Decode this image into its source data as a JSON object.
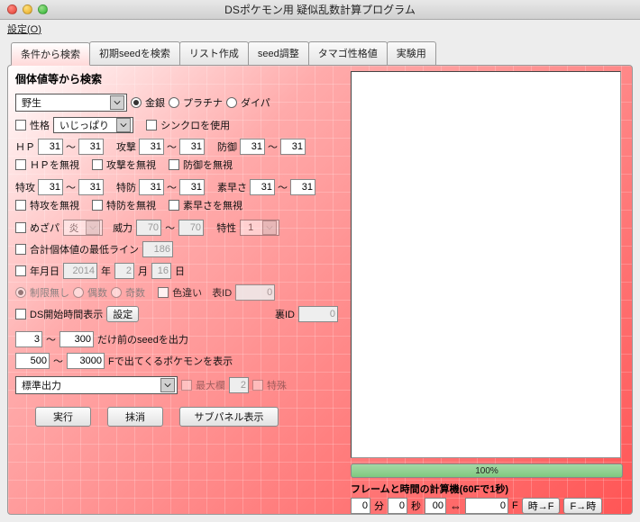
{
  "window": {
    "title": "DSポケモン用 疑似乱数計算プログラム",
    "menu_settings": "設定",
    "menu_settings_key": "O"
  },
  "tabs": [
    "条件から検索",
    "初期seedを検索",
    "リスト作成",
    "seed調整",
    "タマゴ性格値",
    "実験用"
  ],
  "heading": "個体値等から検索",
  "encounter": {
    "type": "野生",
    "game_opts": {
      "gs": "金銀",
      "pt": "プラチナ",
      "dp": "ダイパ"
    }
  },
  "nature": {
    "label": "性格",
    "value": "いじっぱり",
    "sync_label": "シンクロを使用"
  },
  "stats": {
    "hp_label": "ＨＰ",
    "atk_label": "攻撃",
    "def_label": "防御",
    "spa_label": "特攻",
    "spd_label": "特防",
    "spe_label": "素早さ",
    "hp": {
      "lo": "31",
      "hi": "31"
    },
    "atk": {
      "lo": "31",
      "hi": "31"
    },
    "def": {
      "lo": "31",
      "hi": "31"
    },
    "spa": {
      "lo": "31",
      "hi": "31"
    },
    "spd": {
      "lo": "31",
      "hi": "31"
    },
    "spe": {
      "lo": "31",
      "hi": "31"
    },
    "ignore_hp": "ＨＰを無視",
    "ignore_atk": "攻撃を無視",
    "ignore_def": "防御を無視",
    "ignore_spa": "特攻を無視",
    "ignore_spd": "特防を無視",
    "ignore_spe": "素早さを無視"
  },
  "hidden": {
    "mezapa": "めざパ",
    "type": "炎",
    "power_label": "威力",
    "power_lo": "70",
    "power_hi": "70",
    "ability_label": "特性",
    "ability": "1"
  },
  "ivsum": {
    "label": "合計個体値の最低ライン",
    "value": "186"
  },
  "date": {
    "label": "年月日",
    "year": "2014",
    "y": "年",
    "month": "2",
    "m": "月",
    "day": "16",
    "d": "日"
  },
  "limit": {
    "none": "制限無し",
    "even": "偶数",
    "odd": "奇数"
  },
  "shiny": {
    "label": "色違い",
    "omote": "表ID",
    "ura": "裏ID",
    "omote_val": "0",
    "ura_val": "0"
  },
  "dstime": {
    "label": "DS開始時間表示",
    "btn": "設定"
  },
  "seed_before": {
    "lo": "3",
    "hi": "300",
    "label": "だけ前のseedを出力"
  },
  "frame_range": {
    "lo": "500",
    "hi": "3000",
    "label": "Fで出てくるポケモンを表示"
  },
  "output_mode": "標準出力",
  "maxline": {
    "label": "最大欄",
    "val": "2",
    "extra": "特殊"
  },
  "buttons": {
    "run": "実行",
    "clear": "抹消",
    "sub": "サブパネル表示"
  },
  "progress": "100%",
  "frametime": {
    "label": "フレームと時間の計算機(60Fで1秒)",
    "min": "0",
    "min_u": "分",
    "sec": "0",
    "sec_u": "秒",
    "csec": "00",
    "arrow": "⇔",
    "frame": "0",
    "frame_u": "F",
    "btn_tf": "時→F",
    "btn_ft": "F→時"
  }
}
